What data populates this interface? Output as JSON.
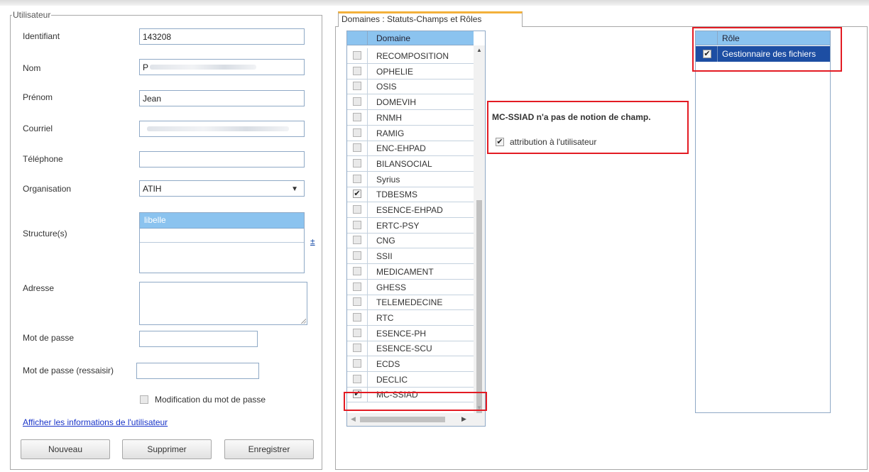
{
  "user_panel": {
    "legend": "Utilisateur",
    "identifiant_label": "Identifiant",
    "identifiant_value": "143208",
    "nom_label": "Nom",
    "nom_value": "P",
    "prenom_label": "Prénom",
    "prenom_value": "Jean",
    "courriel_label": "Courriel",
    "courriel_value": "",
    "telephone_label": "Téléphone",
    "telephone_value": "",
    "organisation_label": "Organisation",
    "organisation_value": "ATIH",
    "structures_label": "Structure(s)",
    "structures_header": "libelle",
    "add_structure_glyph": "±",
    "adresse_label": "Adresse",
    "password_label": "Mot de passe",
    "password_confirm_label": "Mot de passe (ressaisir)",
    "password_change_label": "Modification du mot de passe",
    "password_change_checked": false,
    "show_info_link": "Afficher les informations de l'utilisateur",
    "buttons": {
      "new": "Nouveau",
      "delete": "Supprimer",
      "save": "Enregistrer"
    }
  },
  "domains_panel": {
    "tab_label": "Domaines : Statuts-Champs et Rôles",
    "list_header": "Domaine",
    "domains": [
      {
        "name": "RECOMPOSITION",
        "checked": false
      },
      {
        "name": "OPHELIE",
        "checked": false
      },
      {
        "name": "OSIS",
        "checked": false
      },
      {
        "name": "DOMEVIH",
        "checked": false
      },
      {
        "name": "RNMH",
        "checked": false
      },
      {
        "name": "RAMIG",
        "checked": false
      },
      {
        "name": "ENC-EHPAD",
        "checked": false
      },
      {
        "name": "BILANSOCIAL",
        "checked": false
      },
      {
        "name": "Syrius",
        "checked": false
      },
      {
        "name": "TDBESMS",
        "checked": true
      },
      {
        "name": "ESENCE-EHPAD",
        "checked": false
      },
      {
        "name": "ERTC-PSY",
        "checked": false
      },
      {
        "name": "CNG",
        "checked": false
      },
      {
        "name": "SSII",
        "checked": false
      },
      {
        "name": "MEDICAMENT",
        "checked": false
      },
      {
        "name": "GHESS",
        "checked": false
      },
      {
        "name": "TELEMEDECINE",
        "checked": false
      },
      {
        "name": "RTC",
        "checked": false
      },
      {
        "name": "ESENCE-PH",
        "checked": false
      },
      {
        "name": "ESENCE-SCU",
        "checked": false
      },
      {
        "name": "ECDS",
        "checked": false
      },
      {
        "name": "DECLIC",
        "checked": false
      },
      {
        "name": "MC-SSIAD",
        "checked": true
      }
    ],
    "field_message": "MC-SSIAD n'a pas de notion de champ.",
    "attribution_label": "attribution à l'utilisateur",
    "attribution_checked": true,
    "roles_header": "Rôle",
    "roles": [
      {
        "name": "Gestionnaire des fichiers",
        "checked": true
      }
    ]
  },
  "colors": {
    "header_blue": "#8bc3ef",
    "selected_row": "#1d4ea3",
    "highlight_red": "#e31b23",
    "tab_accent": "#f3b13b"
  }
}
